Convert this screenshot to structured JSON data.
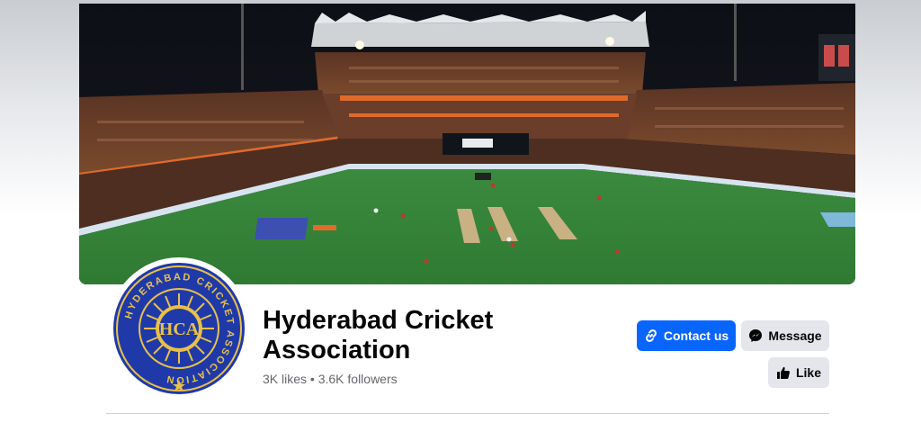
{
  "page": {
    "name": "Hyderabad Cricket Association",
    "stats": "3K likes • 3.6K followers"
  },
  "logo": {
    "ring_text": "HYDERABAD CRICKET ASSOCIATION",
    "monogram": "HCA"
  },
  "actions": {
    "contact_label": "Contact us",
    "message_label": "Message",
    "like_label": "Like"
  },
  "icons": {
    "contact": "link-icon",
    "message": "messenger-icon",
    "like": "thumbs-up-icon"
  },
  "colors": {
    "primary": "#0866ff",
    "secondary_button": "#e4e6eb",
    "logo_blue": "#1f3aa8",
    "logo_gold": "#e8c04a"
  }
}
